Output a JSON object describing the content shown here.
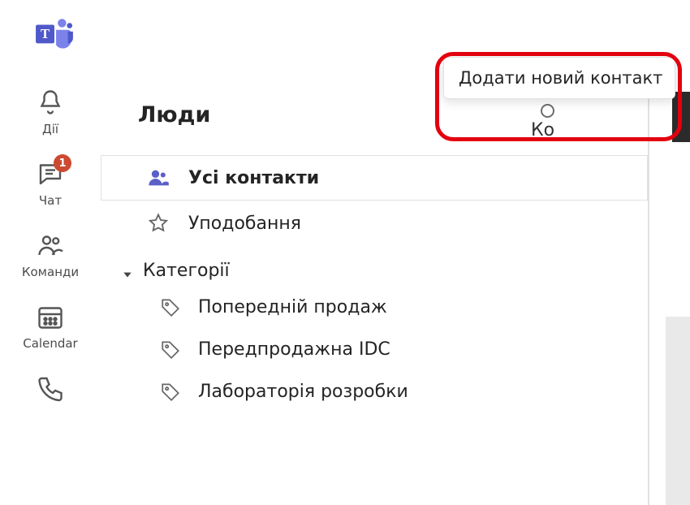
{
  "rail": {
    "items": [
      {
        "key": "activity",
        "label": "Дії",
        "badge": null
      },
      {
        "key": "chat",
        "label": "Чат",
        "badge": "1"
      },
      {
        "key": "teams",
        "label": "Команди",
        "badge": null
      },
      {
        "key": "calendar",
        "label": "Calendar",
        "badge": null
      },
      {
        "key": "calls",
        "label": "",
        "badge": null
      }
    ]
  },
  "panel": {
    "title": "Люди",
    "all_contacts_label": "Усі контакти",
    "favorites_label": "Уподобання",
    "categories_label": "Категорії",
    "categories": [
      {
        "label": "Попередній продаж",
        "ghost": ""
      },
      {
        "label": "Передпродажна IDC",
        "ghost": ""
      },
      {
        "label": "Лабораторія розробки",
        "ghost": ""
      }
    ]
  },
  "callout": {
    "add_contact_label": "Додати новий контакт"
  },
  "right": {
    "entry_name_fragment": "Ко"
  }
}
